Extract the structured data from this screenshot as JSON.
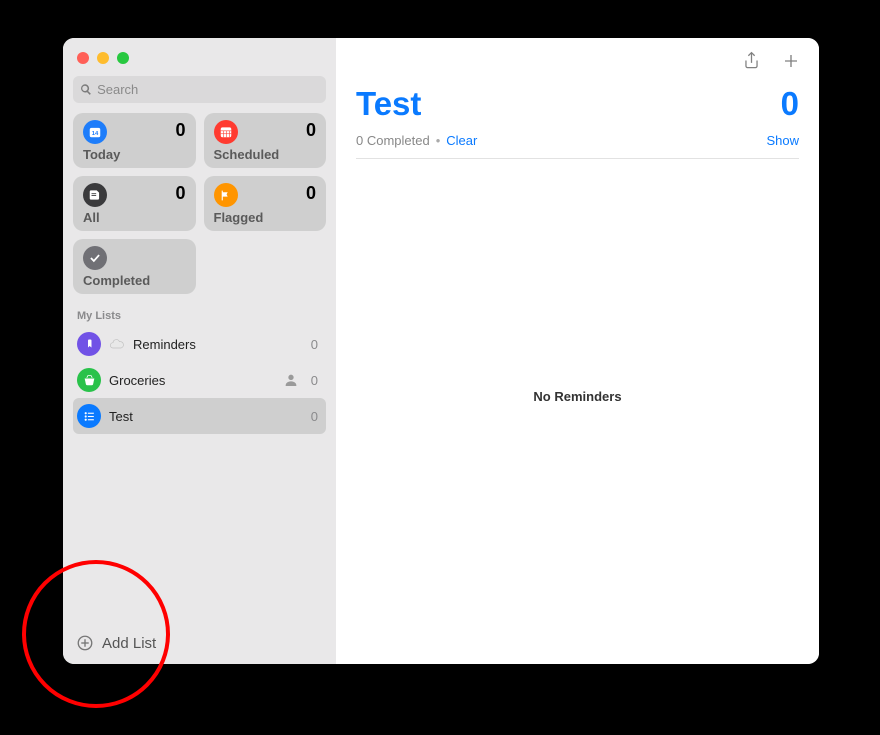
{
  "search": {
    "placeholder": "Search"
  },
  "smart": [
    {
      "id": "today",
      "label": "Today",
      "count": "0",
      "color": "#1e7dfa"
    },
    {
      "id": "scheduled",
      "label": "Scheduled",
      "count": "0",
      "color": "#ff3b30"
    },
    {
      "id": "all",
      "label": "All",
      "count": "0",
      "color": "#3a3a3c"
    },
    {
      "id": "flagged",
      "label": "Flagged",
      "count": "0",
      "color": "#ff9500"
    },
    {
      "id": "completed",
      "label": "Completed",
      "count": "",
      "color": "#707075"
    }
  ],
  "section_header": "My Lists",
  "lists": [
    {
      "id": "reminders",
      "label": "Reminders",
      "count": "0",
      "color": "#7152e6",
      "shared": false,
      "cloud": true
    },
    {
      "id": "groceries",
      "label": "Groceries",
      "count": "0",
      "color": "#29c24a",
      "shared": true,
      "cloud": false
    },
    {
      "id": "test",
      "label": "Test",
      "count": "0",
      "color": "#0a7aff",
      "shared": false,
      "cloud": false
    }
  ],
  "selected_list": "test",
  "add_list_label": "Add List",
  "main": {
    "title": "Test",
    "count": "0",
    "completed_text": "0 Completed",
    "clear_label": "Clear",
    "show_label": "Show",
    "empty_text": "No Reminders"
  }
}
